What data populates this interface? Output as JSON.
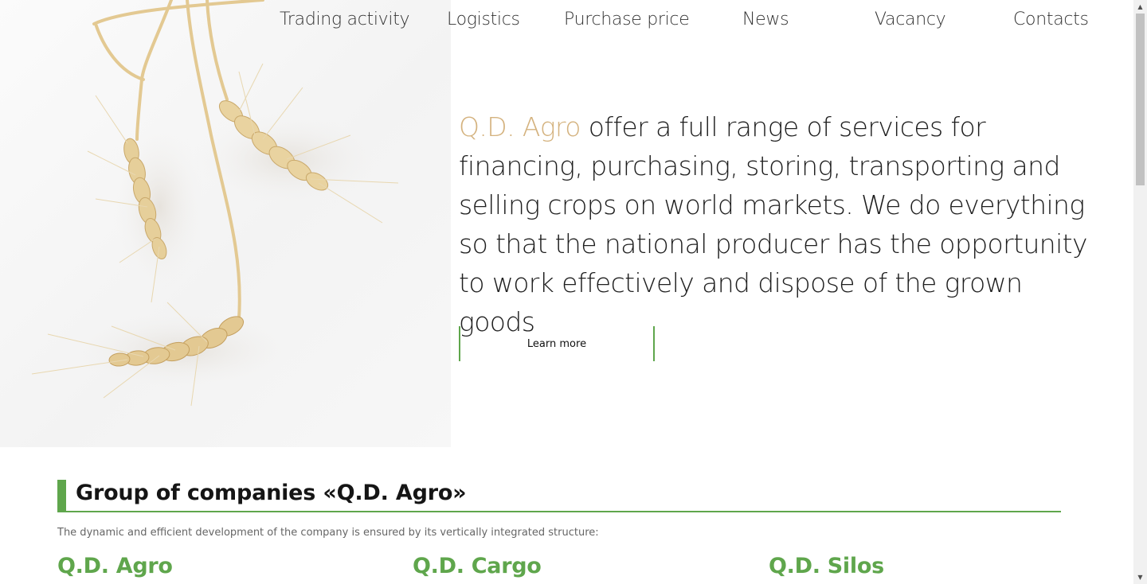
{
  "nav": {
    "items": [
      {
        "label": "Trading activity"
      },
      {
        "label": "Logistics"
      },
      {
        "label": "Purchase price"
      },
      {
        "label": "News"
      },
      {
        "label": "Vacancy"
      },
      {
        "label": "Contacts"
      }
    ]
  },
  "hero": {
    "brand": "Q.D. Agro",
    "text": " offer a full range of services for financing, purchasing, storing, transporting and selling crops on world markets. We do everything so that the national producer has the opportunity to work effectively and dispose of the grown goods",
    "cta_label": "Learn more",
    "image_icon": "wheat-ears-image"
  },
  "group": {
    "title": "Group of companies «Q.D. Agro»",
    "description": "The dynamic and efficient development of the company is ensured by its vertically integrated structure:",
    "companies": [
      {
        "name": "Q.D. Agro"
      },
      {
        "name": "Q.D. Cargo"
      },
      {
        "name": "Q.D. Silos"
      }
    ]
  },
  "colors": {
    "accent_green": "#5fa64c",
    "brand_gold": "#d4b27e"
  }
}
